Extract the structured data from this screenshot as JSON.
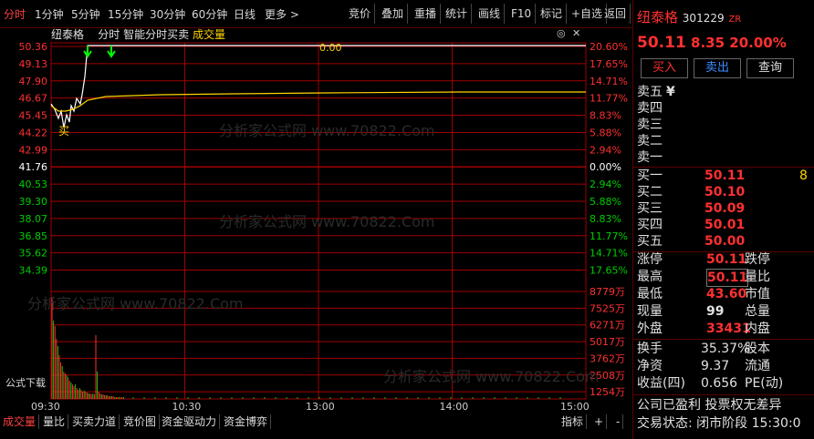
{
  "topbar": {
    "period_tabs": [
      "分时",
      "1分钟",
      "5分钟",
      "15分钟",
      "30分钟",
      "60分钟",
      "日线",
      "更多 >"
    ],
    "tools": [
      "竞价",
      "叠加",
      "重播",
      "统计",
      "画线",
      "F10",
      "标记",
      "+自选",
      "返回"
    ]
  },
  "chart": {
    "stock_name": "纽泰格",
    "mode": "分时",
    "indicator": "智能分时买卖",
    "volume_label": "成交量",
    "marker_value": "0.00",
    "buy_marker": "买",
    "download_label": "公式下载",
    "price_levels": [
      "50.36",
      "49.13",
      "47.90",
      "46.67",
      "45.45",
      "44.22",
      "42.99",
      "41.76",
      "40.53",
      "39.30",
      "38.07",
      "36.85",
      "35.62",
      "34.39"
    ],
    "pct_levels": [
      "20.60%",
      "17.65%",
      "14.71%",
      "11.77%",
      "8.83%",
      "5.88%",
      "2.94%",
      "0.00%",
      "2.94%",
      "5.88%",
      "8.83%",
      "11.77%",
      "14.71%",
      "17.65%"
    ],
    "volume_levels": [
      "8779万",
      "7525万",
      "6271万",
      "5017万",
      "3762万",
      "2508万",
      "1254万"
    ],
    "time_ticks": [
      "09:30",
      "10:30",
      "13:00",
      "14:00",
      "15:00"
    ],
    "colors": {
      "up": "#ff3030",
      "down": "#00cc00",
      "flat": "#ffffff",
      "price_line": "#ffffff",
      "avg_line": "#ffd400",
      "grid": "#a00000"
    }
  },
  "bottom_tabs": [
    "成交量",
    "量比",
    "买卖力道",
    "竞价图",
    "资金驱动力",
    "资金博弈"
  ],
  "bottom_right": {
    "indicator": "指标",
    "plus": "+",
    "minus": "-"
  },
  "quote": {
    "name": "纽泰格",
    "code": "301229",
    "flag": "ZR",
    "price": "50.11",
    "change": "8.35",
    "change_pct": "20.00%",
    "buy_btn": "买入",
    "sell_btn": "卖出",
    "query_btn": "查询",
    "asks": [
      {
        "label": "卖五",
        "price": "¥",
        "vol": ""
      },
      {
        "label": "卖四",
        "price": "",
        "vol": ""
      },
      {
        "label": "卖三",
        "price": "",
        "vol": ""
      },
      {
        "label": "卖二",
        "price": "",
        "vol": ""
      },
      {
        "label": "卖一",
        "price": "",
        "vol": ""
      }
    ],
    "bids": [
      {
        "label": "买一",
        "price": "50.11",
        "vol": "8"
      },
      {
        "label": "买二",
        "price": "50.10",
        "vol": ""
      },
      {
        "label": "买三",
        "price": "50.09",
        "vol": ""
      },
      {
        "label": "买四",
        "price": "50.01",
        "vol": ""
      },
      {
        "label": "买五",
        "price": "50.00",
        "vol": ""
      }
    ],
    "stats": [
      {
        "l": "涨停",
        "v": "50.11",
        "r": "跌停",
        "vc": "red"
      },
      {
        "l": "最高",
        "v": "50.11",
        "r": "量比",
        "vc": "red"
      },
      {
        "l": "最低",
        "v": "43.60",
        "r": "市值",
        "vc": "red"
      },
      {
        "l": "现量",
        "v": "99",
        "r": "总量",
        "vc": "white"
      },
      {
        "l": "外盘",
        "v": "33431",
        "r": "内盘",
        "vc": "red"
      }
    ],
    "fin": [
      {
        "l": "换手",
        "v": "35.37%",
        "r": "股本"
      },
      {
        "l": "净资",
        "v": "9.37",
        "r": "流通"
      },
      {
        "l": "收益(四)",
        "v": "0.656",
        "r": "PE(动)"
      }
    ],
    "note": "公司已盈利 投票权无差异",
    "status": "交易状态: 闭市阶段 15:30:0"
  }
}
